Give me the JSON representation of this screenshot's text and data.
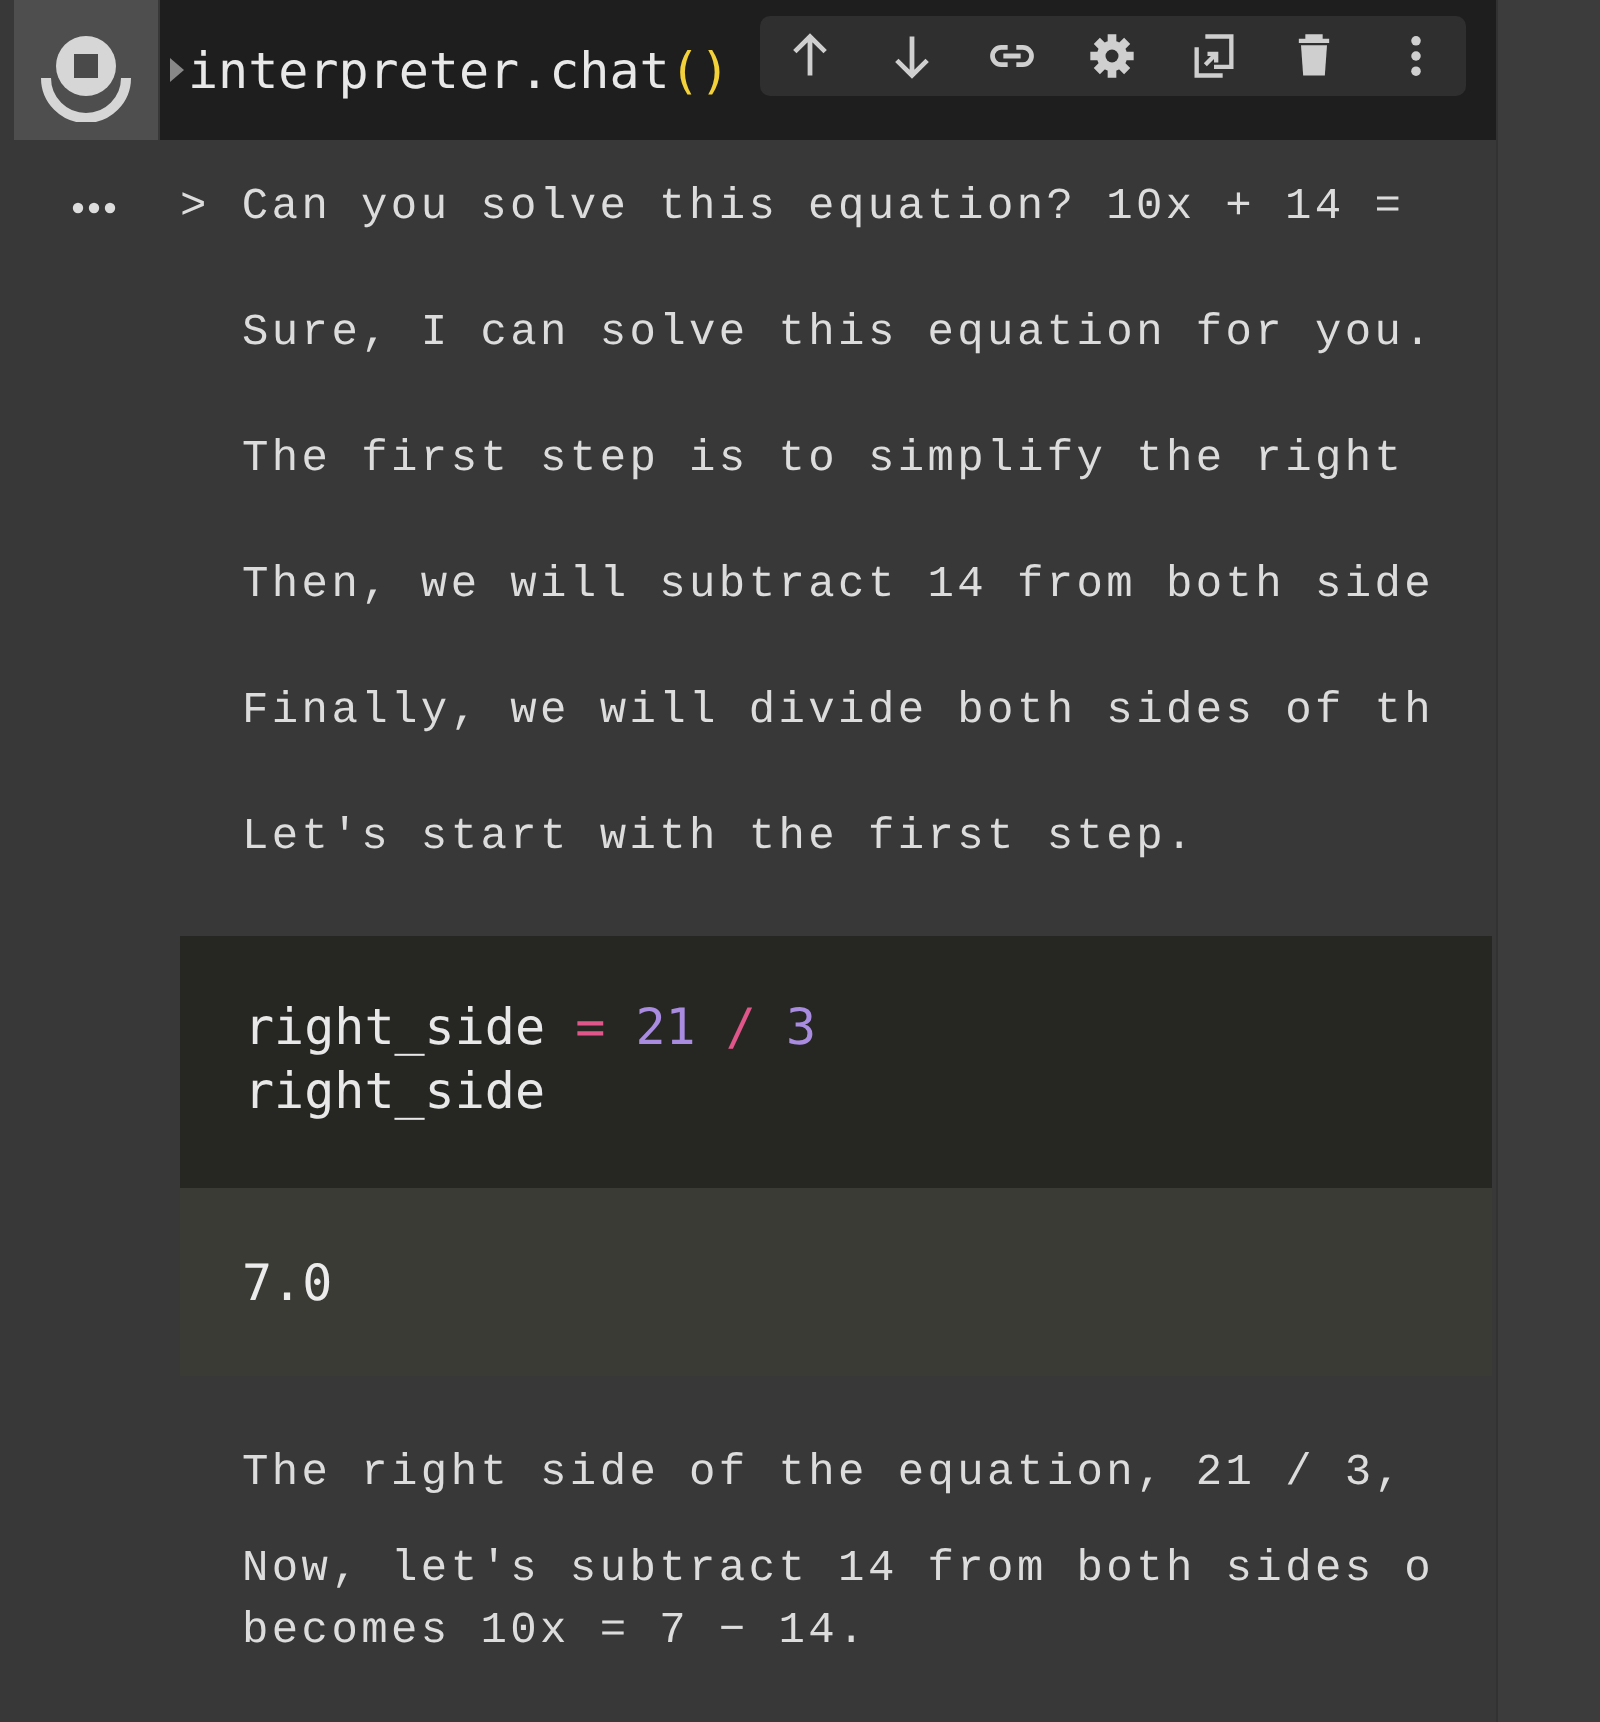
{
  "cell": {
    "code": [
      {
        "kind": "plain",
        "text": "interpreter.chat"
      },
      {
        "kind": "paren",
        "text": "()"
      }
    ]
  },
  "output": {
    "prompt": ">",
    "question": "Can you solve this equation? 10x + 14 =",
    "lines": [
      {
        "kind": "text",
        "text": "Sure, I can solve this equation for you."
      },
      {
        "kind": "text",
        "text": "The first step is to simplify the right"
      },
      {
        "kind": "text",
        "text": "Then, we will subtract 14 from both side"
      },
      {
        "kind": "text",
        "text": "Finally, we will divide both sides of th"
      },
      {
        "kind": "text",
        "text": "Let's start with the first step."
      },
      {
        "kind": "code",
        "code": [
          [
            {
              "kind": "name",
              "text": "right_side"
            },
            {
              "kind": "op",
              "text": "="
            },
            {
              "kind": "num",
              "text": "21"
            },
            {
              "kind": "op",
              "text": "/"
            },
            {
              "kind": "num",
              "text": "3"
            }
          ],
          [
            {
              "kind": "name",
              "text": "right_side"
            }
          ]
        ],
        "result": "7.0"
      },
      {
        "kind": "text",
        "text": "The right side of the equation, 21 / 3,"
      },
      {
        "kind": "text",
        "text": "Now, let's subtract 14 from both sides o\nbecomes 10x = 7 − 14."
      }
    ]
  }
}
